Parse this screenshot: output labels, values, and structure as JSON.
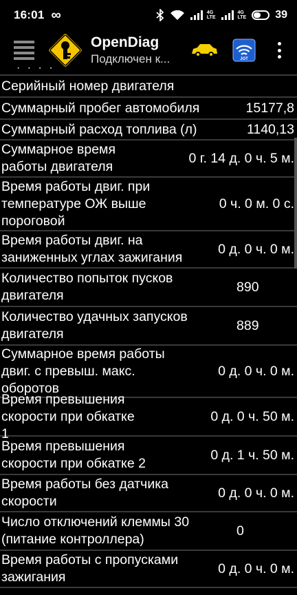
{
  "status_bar": {
    "time": "16:01",
    "infinity": "∞",
    "network_label_1": "4G",
    "network_sub_1": "LTE",
    "network_label_2": "4G",
    "network_sub_2": "LTE",
    "battery_level": "39"
  },
  "app_bar": {
    "title": "OpenDiag",
    "subtitle": "Подключен к...",
    "icons": [
      "menu-icon",
      "app-logo-icon",
      "car-icon",
      "wifi-adapter-icon",
      "more-vert-icon"
    ],
    "adapter_badge": "JOT"
  },
  "list": {
    "overflow_dots": "· · · ·",
    "rows": [
      {
        "label": "Серийный номер двигателя",
        "value": ""
      },
      {
        "label": "Суммарный пробег автомобиля",
        "value": "15177,8"
      },
      {
        "label": "Суммарный расход топлива (л)",
        "value": "1140,13"
      },
      {
        "label": "Суммарное время работы двигателя",
        "value": "0 г. 14 д. 0 ч. 5 м."
      },
      {
        "label": "Время работы двиг. при температуре ОЖ выше пороговой",
        "value": "0 ч. 0 м. 0 с."
      },
      {
        "label": "Время работы двиг. на заниженных углах зажигания",
        "value": "0 д. 0 ч. 0 м."
      },
      {
        "label": "Количество попыток пусков двигателя",
        "value": "890"
      },
      {
        "label": "Количество удачных запусков двигателя",
        "value": "889"
      },
      {
        "label": "Суммарное время работы двиг. с превыш. макс. оборотов",
        "value": "0 д. 0 ч. 0 м."
      },
      {
        "label": "Время превышения скорости при обкатке 1",
        "value": "0 д. 0 ч. 50 м."
      },
      {
        "label": "Время превышения скорости при обкатке 2",
        "value": "0 д. 1 ч. 50 м."
      },
      {
        "label": "Время работы без датчика скорости",
        "value": "0 д. 0 ч. 0 м."
      },
      {
        "label": "Число отключений клеммы 30 (питание контроллера)",
        "value": "0"
      },
      {
        "label": "Время работы с пропусками зажигания",
        "value": "0 д. 0 ч. 0 м."
      }
    ]
  },
  "colors": {
    "background": "#000000",
    "divider": "#3a3a3a",
    "logo_yellow": "#f5c400",
    "car_yellow": "#f3d000",
    "adapter_blue": "#1e5fd0"
  }
}
